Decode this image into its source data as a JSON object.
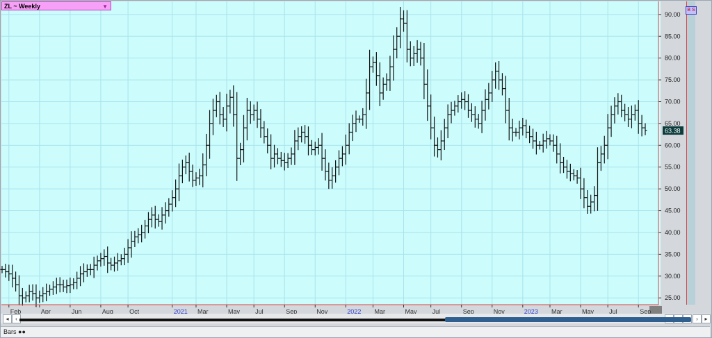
{
  "toolbar": {
    "symbol_label": "ZL ~ Weekly",
    "dropdown_icon": "triangle-down-icon"
  },
  "status_bar": {
    "tab_label": "Bars",
    "tab_icon": "binoculars-icon"
  },
  "colors": {
    "plot_bg": "#ccfcfc",
    "bar": "#111111",
    "grid": "#a8e4ec",
    "axis_line": "#e04040",
    "price_tag_bg": "#0c3c3c",
    "year_label": "#2f3fd0"
  },
  "chart_data": {
    "type": "ohlc",
    "y_axis": {
      "ylim": [
        23.6,
        93.0
      ],
      "ticks": [
        25,
        30,
        35,
        40,
        45,
        50,
        55,
        60,
        65,
        70,
        75,
        80,
        85,
        90
      ],
      "position": "right"
    },
    "x_axis": {
      "ticks": [
        {
          "label": "Feb",
          "week": 2,
          "year": false
        },
        {
          "label": "Apr",
          "week": 11,
          "year": false
        },
        {
          "label": "Jun",
          "week": 20,
          "year": false
        },
        {
          "label": "Aug",
          "week": 29,
          "year": false
        },
        {
          "label": "Oct",
          "week": 37,
          "year": false
        },
        {
          "label": "2021",
          "week": 50,
          "year": true
        },
        {
          "label": "Mar",
          "week": 57,
          "year": false
        },
        {
          "label": "May",
          "week": 66,
          "year": false
        },
        {
          "label": "Jul",
          "week": 74,
          "year": false
        },
        {
          "label": "Sep",
          "week": 83,
          "year": false
        },
        {
          "label": "Nov",
          "week": 92,
          "year": false
        },
        {
          "label": "2022",
          "week": 101,
          "year": true
        },
        {
          "label": "Mar",
          "week": 109,
          "year": false
        },
        {
          "label": "May",
          "week": 118,
          "year": false
        },
        {
          "label": "Jul",
          "week": 126,
          "year": false
        },
        {
          "label": "Sep",
          "week": 135,
          "year": false
        },
        {
          "label": "Nov",
          "week": 144,
          "year": false
        },
        {
          "label": "2023",
          "week": 153,
          "year": true
        },
        {
          "label": "Mar",
          "week": 161,
          "year": false
        },
        {
          "label": "May",
          "week": 170,
          "year": false
        },
        {
          "label": "Jul",
          "week": 178,
          "year": false
        },
        {
          "label": "Sep",
          "week": 187,
          "year": false
        }
      ]
    },
    "last_price": "63.38",
    "weekly_closes": [
      31.5,
      31.0,
      30.5,
      29.5,
      28.0,
      25.5,
      25.0,
      25.5,
      26.5,
      26.0,
      25.0,
      25.5,
      26.0,
      26.5,
      27.0,
      27.5,
      28.0,
      28.0,
      27.5,
      27.8,
      28.0,
      28.5,
      29.5,
      30.5,
      31.0,
      31.5,
      31.5,
      32.5,
      33.5,
      34.0,
      34.5,
      33.0,
      32.5,
      33.0,
      33.5,
      34.0,
      35.0,
      36.5,
      38.0,
      39.0,
      39.5,
      40.0,
      41.5,
      43.0,
      44.0,
      43.0,
      42.5,
      44.0,
      45.0,
      46.5,
      48.0,
      50.0,
      53.0,
      55.0,
      56.0,
      54.0,
      52.0,
      52.5,
      53.0,
      55.5,
      60.0,
      65.0,
      68.0,
      70.0,
      67.0,
      66.0,
      69.0,
      71.0,
      67.0,
      57.0,
      59.0,
      64.0,
      68.0,
      67.0,
      68.0,
      66.0,
      64.0,
      62.0,
      60.0,
      57.0,
      58.0,
      57.0,
      56.5,
      56.0,
      57.0,
      58.0,
      61.0,
      62.0,
      63.0,
      62.0,
      60.0,
      59.0,
      59.5,
      60.0,
      57.0,
      54.0,
      52.0,
      53.0,
      55.0,
      57.0,
      58.0,
      60.0,
      63.0,
      65.0,
      66.0,
      66.0,
      67.0,
      72.0,
      78.0,
      79.0,
      76.0,
      72.0,
      74.0,
      75.0,
      78.0,
      82.0,
      85.0,
      89.0,
      88.0,
      82.0,
      80.0,
      81.0,
      82.0,
      80.0,
      74.0,
      69.0,
      64.0,
      60.0,
      59.0,
      61.0,
      64.0,
      67.0,
      68.0,
      69.0,
      70.0,
      70.5,
      70.0,
      68.0,
      67.0,
      66.0,
      65.0,
      68.0,
      70.5,
      72.0,
      75.0,
      77.0,
      75.0,
      73.0,
      68.0,
      64.0,
      63.0,
      63.0,
      64.0,
      64.5,
      63.0,
      62.0,
      61.0,
      60.0,
      60.0,
      61.0,
      61.5,
      61.0,
      60.0,
      58.0,
      56.0,
      55.0,
      54.0,
      53.5,
      53.0,
      52.5,
      50.0,
      48.0,
      46.0,
      47.0,
      48.5,
      56.0,
      58.0,
      60.0,
      64.0,
      67.0,
      69.0,
      70.0,
      68.0,
      67.0,
      66.0,
      67.0,
      68.0,
      65.0,
      64.0,
      63.38
    ]
  }
}
